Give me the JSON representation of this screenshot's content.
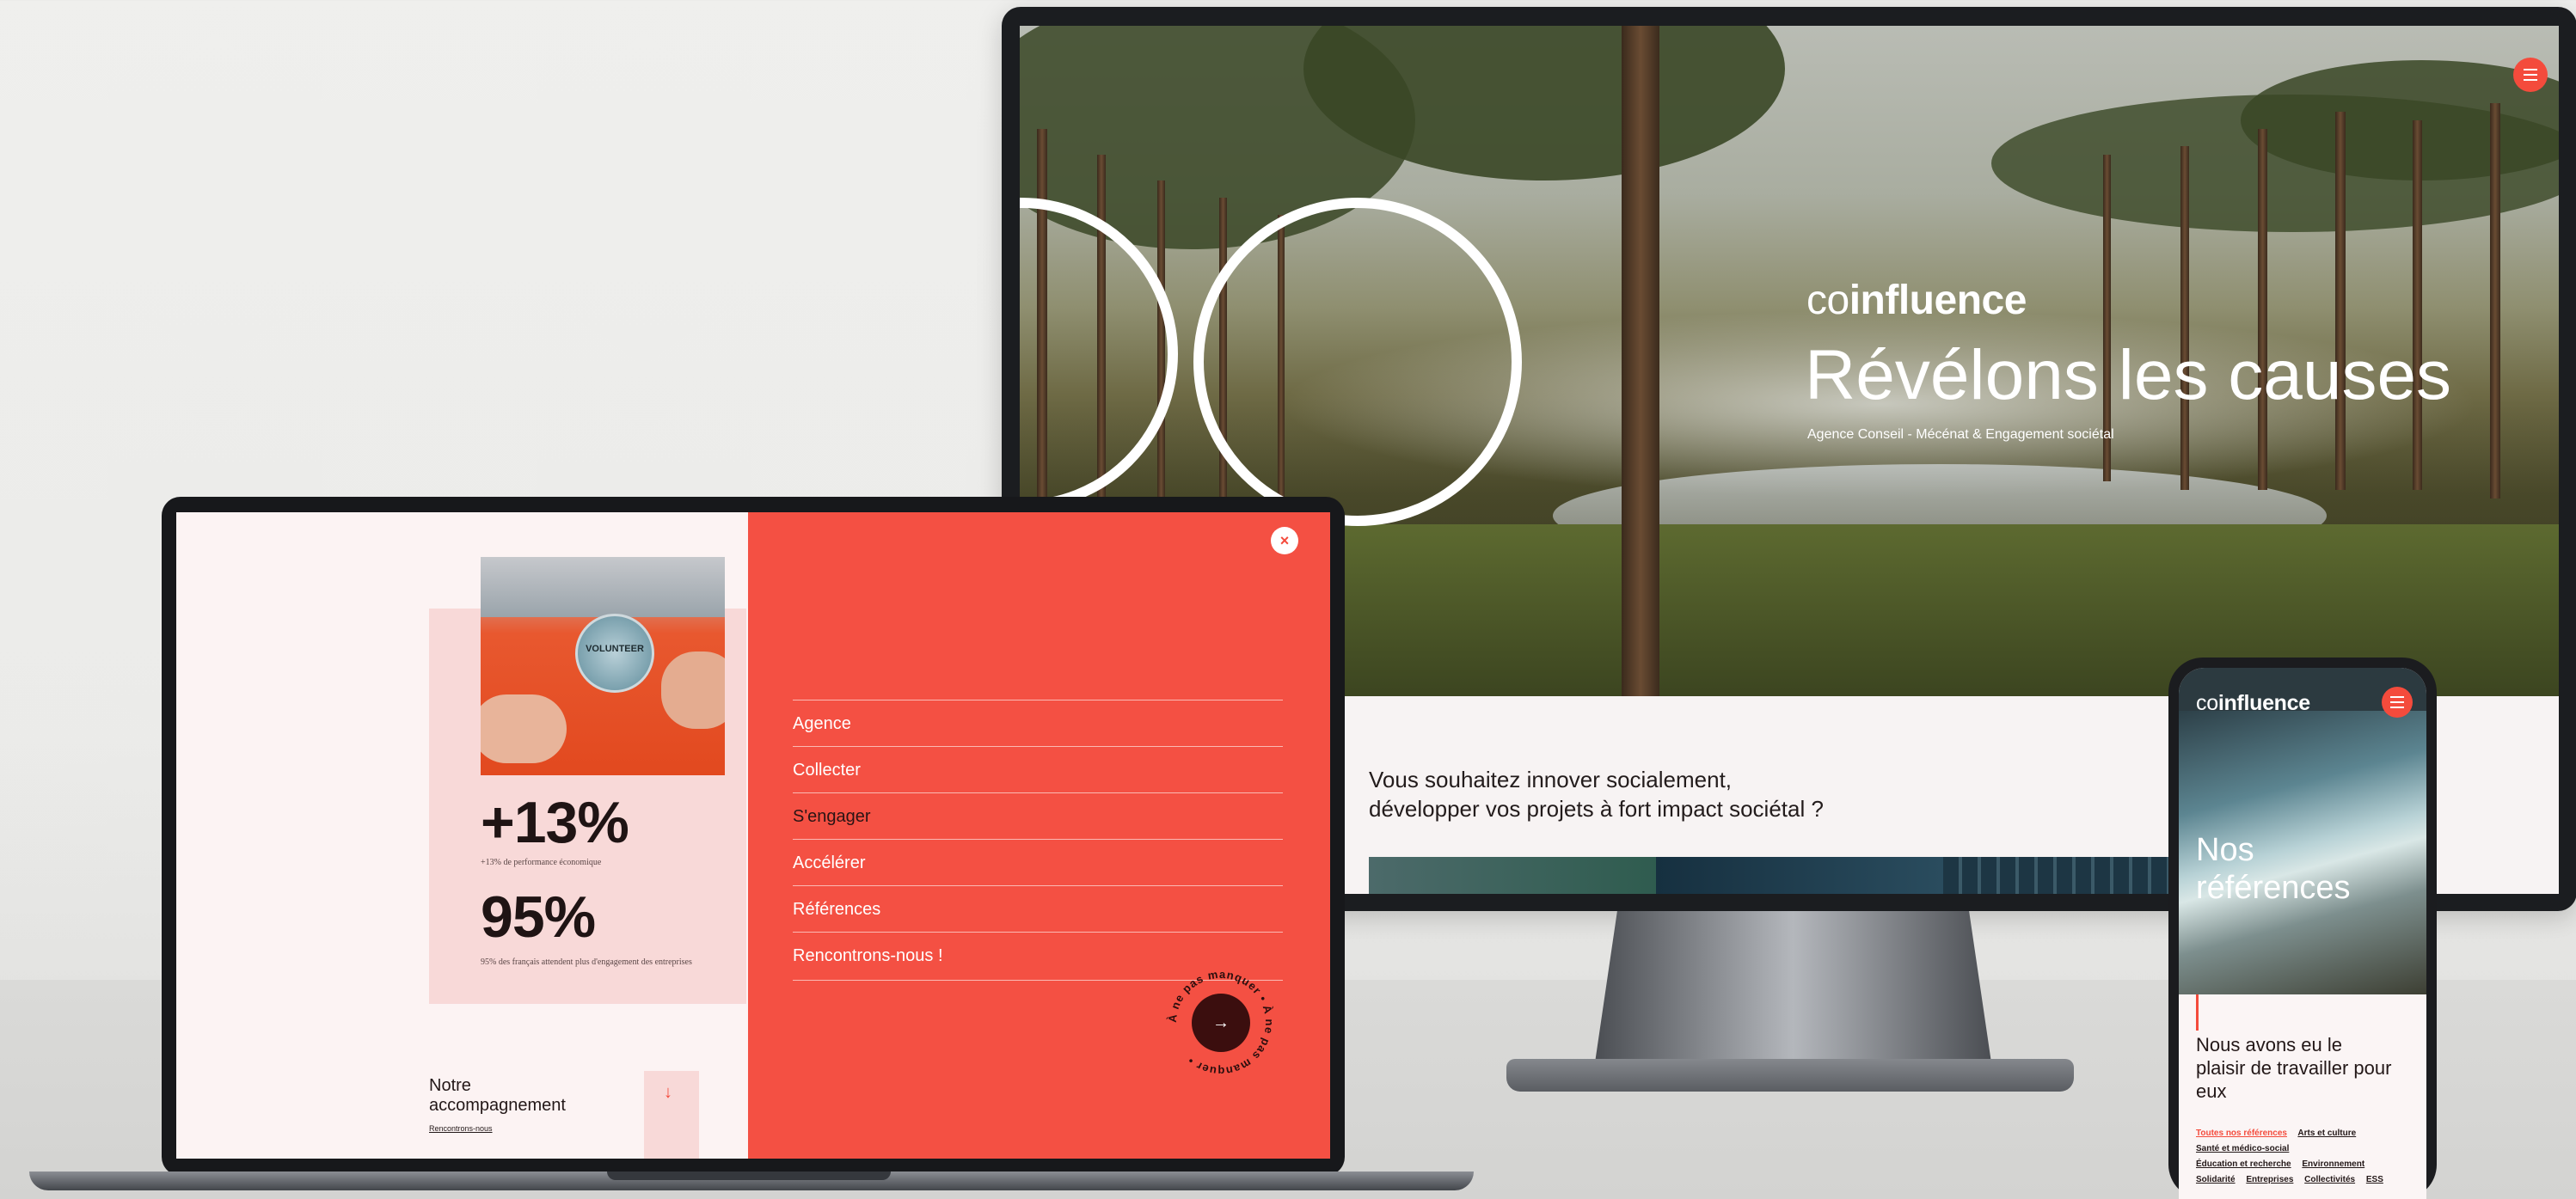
{
  "monitor": {
    "brand_prefix": "co",
    "brand_suffix": "influence",
    "hero_title": "Révélons les causes",
    "hero_subtitle": "Agence Conseil - Mécénat & Engagement sociétal",
    "menu_icon": "hamburger-icon",
    "content_line1": "Vous souhaitez innover socialement,",
    "content_line2": "développer vos projets à fort impact sociétal ?"
  },
  "laptop": {
    "photo_badge": "VOLUNTEER",
    "stat1_value": "+13%",
    "stat1_caption": "+13% de performance économique",
    "stat2_value": "95%",
    "stat2_caption": "95% des français attendent plus d'engagement des entreprises",
    "accompany_title_line1": "Notre",
    "accompany_title_line2": "accompagnement",
    "accompany_link": "Rencontrons-nous",
    "close_icon": "close-icon",
    "close_glyph": "×",
    "nav": [
      {
        "label": "Agence"
      },
      {
        "label": "Collecter"
      },
      {
        "label": "S'engager"
      },
      {
        "label": "Accélérer"
      },
      {
        "label": "Références"
      },
      {
        "label": "Rencontrons-nous !"
      }
    ],
    "cta_text": "À ne pas manquer • À ne pas manquer •",
    "cta_arrow": "→",
    "down_arrow": "↓"
  },
  "phone": {
    "brand_prefix": "co",
    "brand_suffix": "influence",
    "title_line1": "Nos",
    "title_line2": "références",
    "heading": "Nous avons eu le plaisir de travailler pour eux",
    "tags": [
      {
        "label": "Toutes nos références",
        "active": true
      },
      {
        "label": "Arts et culture"
      },
      {
        "label": "Santé et médico-social"
      },
      {
        "label": "Éducation et recherche"
      },
      {
        "label": "Environnement"
      },
      {
        "label": "Solidarité"
      },
      {
        "label": "Entreprises"
      },
      {
        "label": "Collectivités"
      },
      {
        "label": "ESS"
      }
    ]
  },
  "colors": {
    "accent": "#f44b3c",
    "background": "#efefed",
    "dark_text": "#231818"
  }
}
